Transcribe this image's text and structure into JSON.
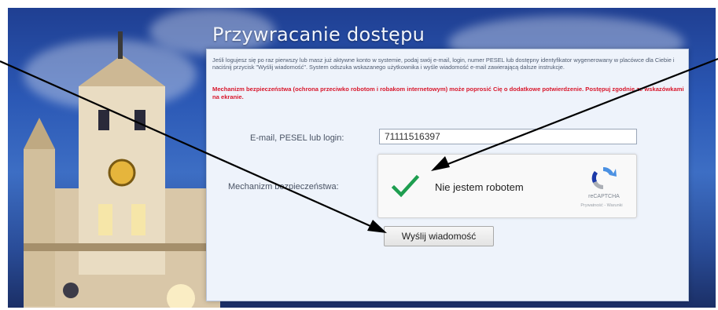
{
  "form": {
    "title": "Przywracanie dostępu",
    "intro": "Jeśli logujesz się po raz pierwszy lub masz już aktywne konto w systemie, podaj swój e-mail, login, numer PESEL lub dostępny identyfikator wygenerowany w placówce dla Ciebie i naciśnij przycisk \"Wyślij wiadomość\". System odszuka wskazanego użytkownika i wyśle wiadomość e-mail zawierającą dalsze instrukcje.",
    "warning": "Mechanizm bezpieczeństwa (ochrona przeciwko robotom i robakom internetowym) może poprosić Cię o dodatkowe potwierdzenie. Postępuj zgodnie ze wskazówkami na ekranie.",
    "email_label": "E-mail, PESEL lub login:",
    "email_value": "71111516397",
    "security_label": "Mechanizm bezpieczeństwa:",
    "send_label": "Wyślij wiadomość"
  },
  "recaptcha": {
    "checkbox_label": "Nie jestem robotem",
    "brand": "reCAPTCHA",
    "links": "Prywatność - Warunki",
    "check_color": "#1e9e50"
  },
  "colors": {
    "title": "#f2f5fc",
    "warning": "#d8162b",
    "panel": "#eef3fb",
    "sky": "#2b58b5"
  }
}
